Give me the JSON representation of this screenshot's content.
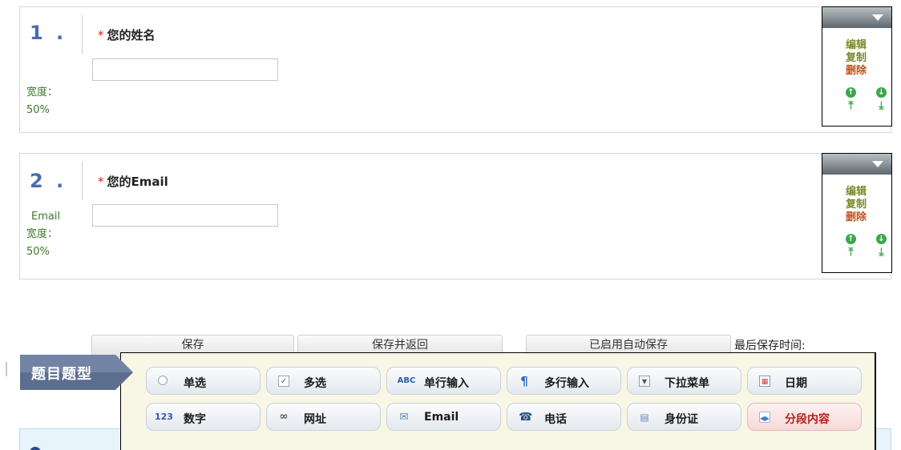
{
  "questions": [
    {
      "number": "1 .",
      "required_mark": "*",
      "title": "您的姓名",
      "input_value": "",
      "side_lines": [
        "宽度：",
        "50%"
      ]
    },
    {
      "number": "2 .",
      "required_mark": "*",
      "title": "您的Email",
      "input_value": "",
      "side_lines": [
        "Email",
        "宽度：",
        "50%"
      ]
    }
  ],
  "controls": {
    "edit": "编辑",
    "copy": "复制",
    "delete": "删除",
    "icons": [
      "arrow-up-icon",
      "arrow-down-icon",
      "move-top-icon",
      "move-bottom-icon"
    ]
  },
  "toolbar": {
    "save": "保存",
    "save_return": "保存并返回",
    "autosave": "已启用自动保存",
    "last_save": "最后保存时间:"
  },
  "question_types": {
    "label": "题目题型",
    "row1": [
      {
        "label": "单选",
        "icon": "radio-icon"
      },
      {
        "label": "多选",
        "icon": "checkbox-icon"
      },
      {
        "label": "单行输入",
        "icon": "abc-icon"
      },
      {
        "label": "多行输入",
        "icon": "paragraph-icon"
      },
      {
        "label": "下拉菜单",
        "icon": "dropdown-icon"
      },
      {
        "label": "日期",
        "icon": "calendar-icon"
      }
    ],
    "row2": [
      {
        "label": "数字",
        "icon": "number-icon"
      },
      {
        "label": "网址",
        "icon": "link-icon"
      },
      {
        "label": "Email",
        "icon": "envelope-icon"
      },
      {
        "label": "电话",
        "icon": "phone-icon"
      },
      {
        "label": "身份证",
        "icon": "id-card-icon"
      },
      {
        "label": "分段内容",
        "icon": "section-icon"
      }
    ]
  },
  "colors": {
    "number": "#4a6bb3",
    "side_text": "#3a7a2a",
    "delete": "#c0501a",
    "panel_bg": "#f8f6e4",
    "type_label_bg": "#5c6e8e"
  }
}
